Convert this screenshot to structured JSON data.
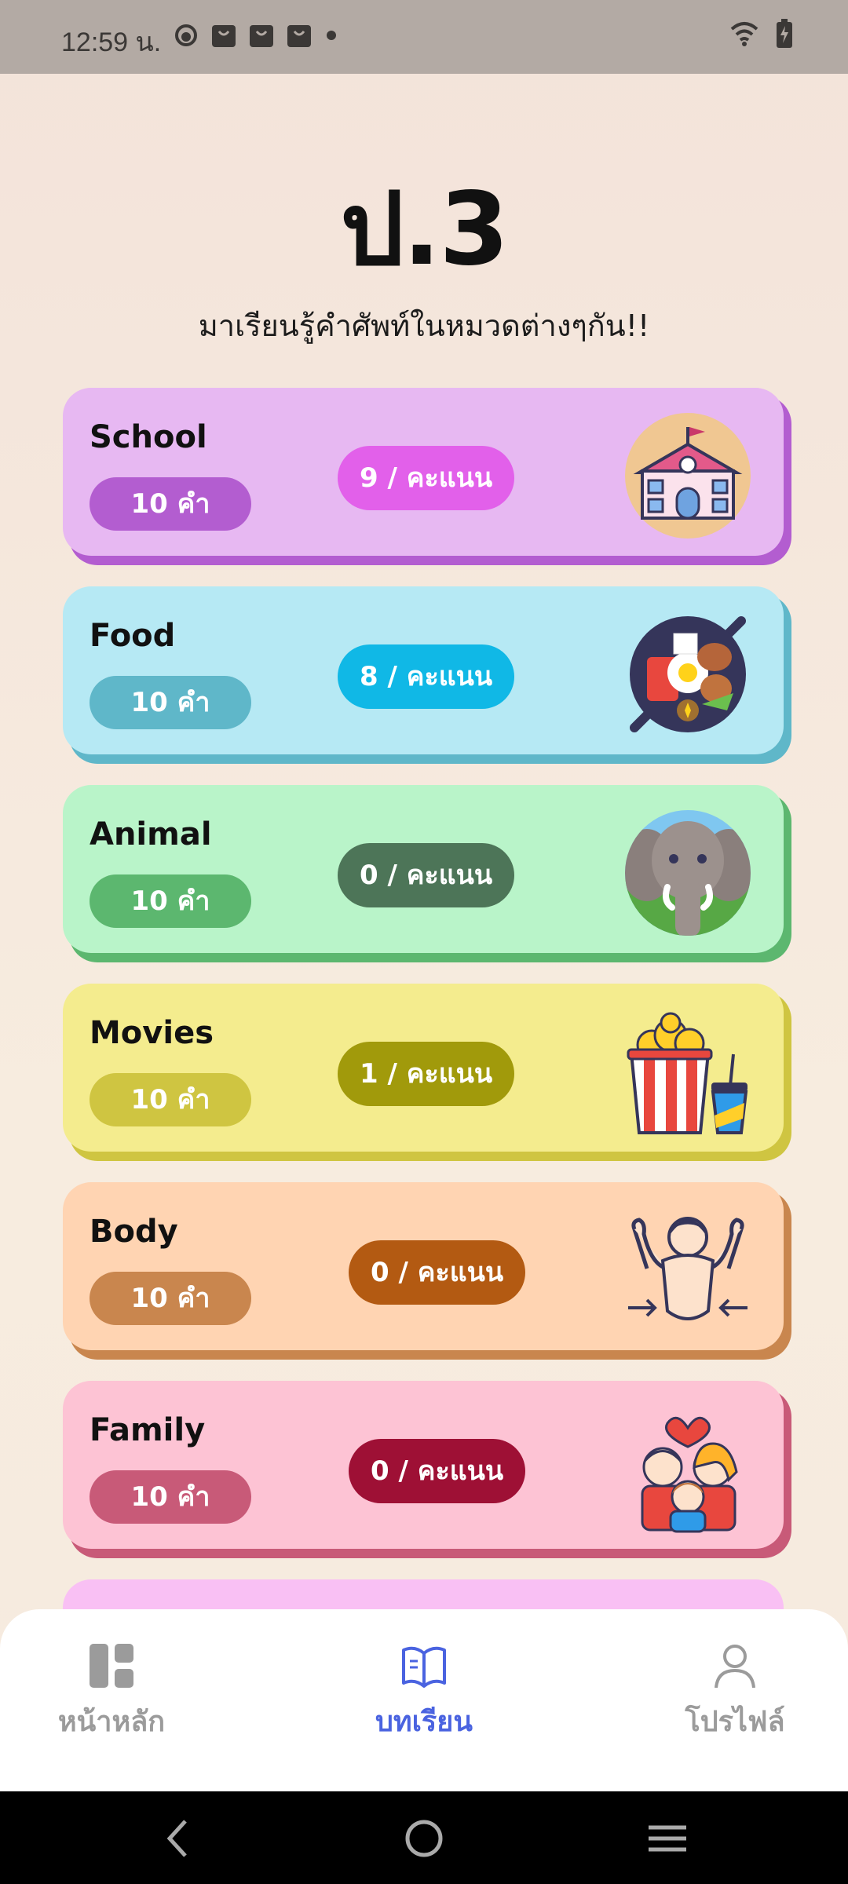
{
  "status": {
    "time": "12:59 น."
  },
  "page": {
    "title": "ป.3",
    "subtitle": "มาเรียนรู้คำศัพท์ในหมวดต่างๆกัน!!"
  },
  "categories": [
    {
      "name": "School",
      "count": "10 คำ",
      "score": "9 / คะแนน",
      "icon": "school-building-icon",
      "colors": {
        "bg": "#e7b8f2",
        "shadow": "#b35dd0",
        "pill": "#b35dd0",
        "score": "#e260ea"
      }
    },
    {
      "name": "Food",
      "count": "10 คำ",
      "score": "8 / คะแนน",
      "icon": "food-pan-icon",
      "colors": {
        "bg": "#b6e9f4",
        "shadow": "#5fb7c9",
        "pill": "#5fb7c9",
        "score": "#10b8e6"
      }
    },
    {
      "name": "Animal",
      "count": "10 คำ",
      "score": "0 / คะแนน",
      "icon": "elephant-icon",
      "colors": {
        "bg": "#b9f4c9",
        "shadow": "#5cb76f",
        "pill": "#5cb76f",
        "score": "#4d7558"
      }
    },
    {
      "name": "Movies",
      "count": "10 คำ",
      "score": "1 / คะแนน",
      "icon": "popcorn-drink-icon",
      "colors": {
        "bg": "#f4ec8e",
        "shadow": "#cfc541",
        "pill": "#cfc541",
        "score": "#a19a0b"
      }
    },
    {
      "name": "Body",
      "count": "10 คำ",
      "score": "0 / คะแนน",
      "icon": "body-man-icon",
      "colors": {
        "bg": "#ffd4b2",
        "shadow": "#c9864e",
        "pill": "#c9864e",
        "score": "#b35a12"
      }
    },
    {
      "name": "Family",
      "count": "10 คำ",
      "score": "0 / คะแนน",
      "icon": "family-icon",
      "colors": {
        "bg": "#fdc3d4",
        "shadow": "#c85a78",
        "pill": "#c85a78",
        "score": "#9e1035"
      }
    }
  ],
  "nav": {
    "home": "หน้าหลัก",
    "lessons": "บทเรียน",
    "profile": "โปรไฟล์",
    "active": "lessons",
    "active_color": "#4a63e0",
    "inactive_color": "#9b9b9b"
  }
}
